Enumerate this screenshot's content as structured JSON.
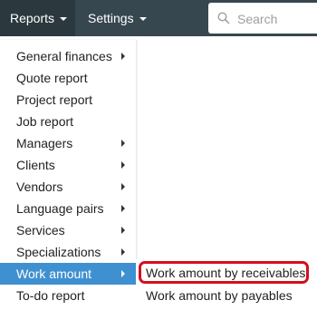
{
  "navbar": {
    "reports_label": "Reports",
    "settings_label": "Settings",
    "search_placeholder": "Search"
  },
  "icons": {
    "search": "search-icon",
    "caret": "caret-down-icon",
    "submenu_arrow": "chevron-right-icon"
  },
  "colors": {
    "navbar": "#37474f",
    "active_nav": "#2b383e",
    "active_item": "#3f90d0",
    "highlight": "#d40f1e"
  },
  "menu": {
    "items": [
      {
        "label": "General finances",
        "has_submenu": true
      },
      {
        "label": "Quote report",
        "has_submenu": false
      },
      {
        "label": "Project report",
        "has_submenu": false
      },
      {
        "label": "Job report",
        "has_submenu": false
      },
      {
        "label": "Managers",
        "has_submenu": true
      },
      {
        "label": "Clients",
        "has_submenu": true
      },
      {
        "label": "Vendors",
        "has_submenu": true
      },
      {
        "label": "Language pairs",
        "has_submenu": true
      },
      {
        "label": "Services",
        "has_submenu": true
      },
      {
        "label": "Specializations",
        "has_submenu": true
      },
      {
        "label": "Work amount",
        "has_submenu": true,
        "active": true
      },
      {
        "label": "To-do report",
        "has_submenu": false
      }
    ]
  },
  "submenu": {
    "items": [
      {
        "label": "Work amount by receivables",
        "highlighted": true
      },
      {
        "label": "Work amount by payables",
        "highlighted": false
      }
    ]
  }
}
